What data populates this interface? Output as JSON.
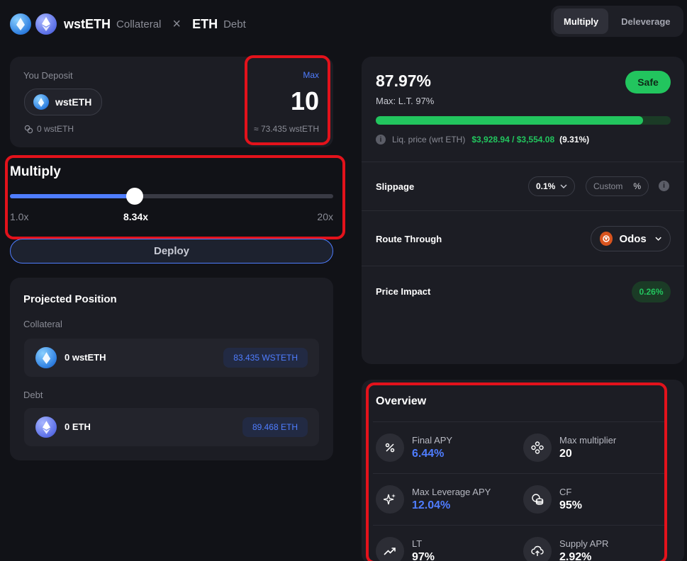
{
  "header": {
    "collateral_token": "wstETH",
    "collateral_label": "Collateral",
    "separator": "×",
    "debt_token": "ETH",
    "debt_label": "Debt",
    "tabs": [
      {
        "label": "Multiply",
        "active": true
      },
      {
        "label": "Deleverage",
        "active": false
      }
    ]
  },
  "deposit": {
    "label": "You Deposit",
    "token": "wstETH",
    "balance": "0 wstETH",
    "max_label": "Max",
    "amount": "10",
    "amount_equiv": "≈ 73.435 wstETH"
  },
  "multiply": {
    "title": "Multiply",
    "min_label": "1.0x",
    "current_label": "8.34x",
    "max_label": "20x",
    "min": 1.0,
    "max": 20,
    "value": 8.34
  },
  "deploy_label": "Deploy",
  "projected": {
    "title": "Projected Position",
    "collateral_label": "Collateral",
    "collateral_amount": "0 wstETH",
    "collateral_projected": "83.435 WSTETH",
    "debt_label": "Debt",
    "debt_amount": "0 ETH",
    "debt_projected": "89.468 ETH"
  },
  "risk": {
    "ltv": "87.97%",
    "max_lt": "Max: L.T. 97%",
    "badge": "Safe",
    "ltv_fraction": 0.9069,
    "liq_label": "Liq. price (wrt ETH)",
    "liq_values": "$3,928.94 / $3,554.08",
    "liq_pct": "(9.31%)"
  },
  "settings": {
    "slippage_label": "Slippage",
    "slippage_value": "0.1%",
    "custom_placeholder": "Custom",
    "custom_unit": "%",
    "route_label": "Route Through",
    "route_value": "Odos",
    "impact_label": "Price Impact",
    "impact_value": "0.26%"
  },
  "overview": {
    "title": "Overview",
    "items": [
      {
        "label": "Final APY",
        "value": "6.44%",
        "icon": "percent-icon"
      },
      {
        "label": "Max multiplier",
        "value": "20",
        "icon": "nodes-icon"
      },
      {
        "label": "Max Leverage APY",
        "value": "12.04%",
        "icon": "sparkle-icon"
      },
      {
        "label": "CF",
        "value": "95%",
        "icon": "coins-icon"
      },
      {
        "label": "LT",
        "value": "97%",
        "icon": "trend-up-icon"
      },
      {
        "label": "Supply APR",
        "value": "2.92%",
        "icon": "cloud-upload-icon"
      }
    ]
  },
  "colors": {
    "accent_blue": "#4f7dff",
    "safe_green": "#22c55e",
    "highlight_red": "#e3121b"
  }
}
